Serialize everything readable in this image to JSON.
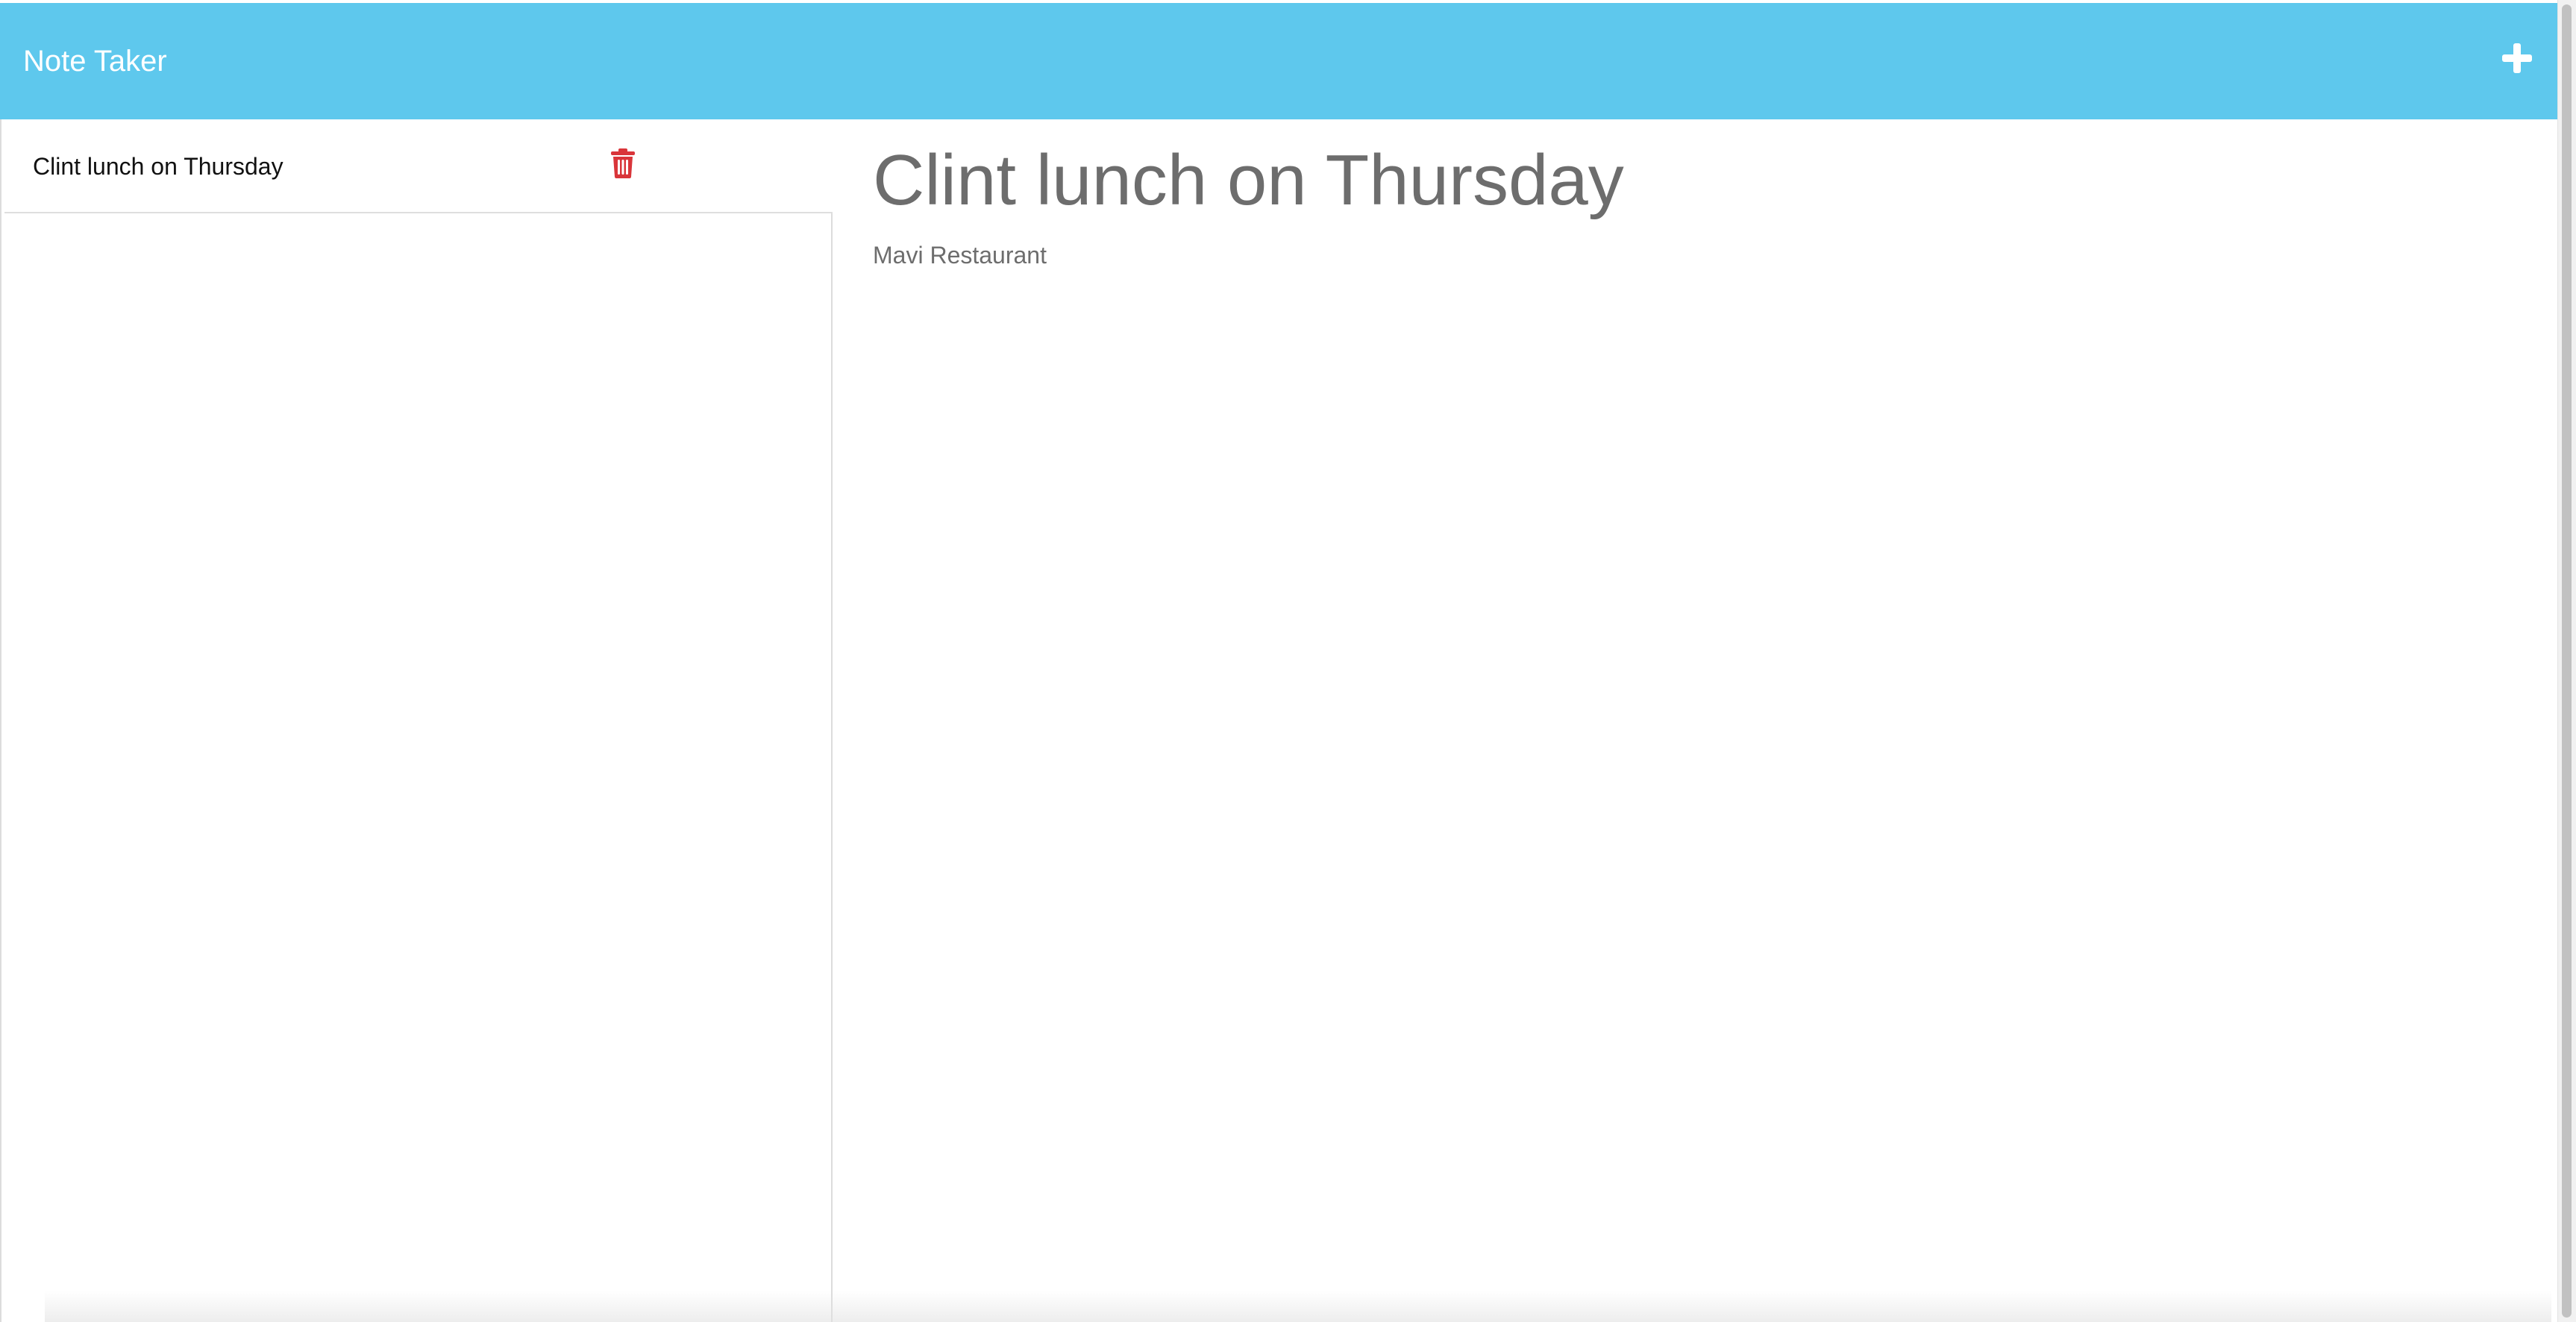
{
  "app": {
    "title": "Note Taker",
    "accent_color": "#5ec8ed",
    "new_note_icon": "plus-icon"
  },
  "sidebar": {
    "notes": [
      {
        "title": "Clint lunch on Thursday",
        "delete_icon": "trash-icon",
        "delete_icon_color": "#d9353a"
      }
    ]
  },
  "editor": {
    "title": "Clint lunch on Thursday",
    "body": "Mavi Restaurant"
  }
}
